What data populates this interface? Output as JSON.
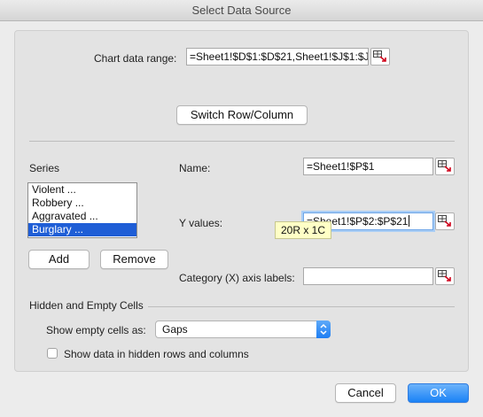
{
  "window": {
    "title": "Select Data Source"
  },
  "chart_range": {
    "label": "Chart data range:",
    "value": "=Sheet1!$D$1:$D$21,Sheet1!$J$1:$J"
  },
  "switch_button": "Switch Row/Column",
  "series": {
    "heading": "Series",
    "items": [
      {
        "label": "Violent ..."
      },
      {
        "label": "Robbery ..."
      },
      {
        "label": "Aggravated ..."
      },
      {
        "label": "Burglary ..."
      }
    ],
    "selected_index": 3,
    "add_label": "Add",
    "remove_label": "Remove"
  },
  "name_field": {
    "label": "Name:",
    "value": "=Sheet1!$P$1"
  },
  "y_values_field": {
    "label": "Y values:",
    "value": "=Sheet1!$P$2:$P$21"
  },
  "tooltip": "20R x 1C",
  "category_field": {
    "label": "Category (X) axis labels:",
    "value": ""
  },
  "hidden_empty": {
    "heading": "Hidden and Empty Cells",
    "show_empty_label": "Show empty cells as:",
    "show_empty_value": "Gaps",
    "show_hidden_label": "Show data in hidden rows and columns",
    "show_hidden_checked": false
  },
  "footer": {
    "cancel_label": "Cancel",
    "ok_label": "OK"
  },
  "colors": {
    "accent": "#1b82f6",
    "selection": "#1f5ed6",
    "tooltip_bg": "#ffffc6"
  },
  "icons": {
    "range_picker": "range-picker-icon",
    "select_arrows": "updown-arrows-icon"
  }
}
